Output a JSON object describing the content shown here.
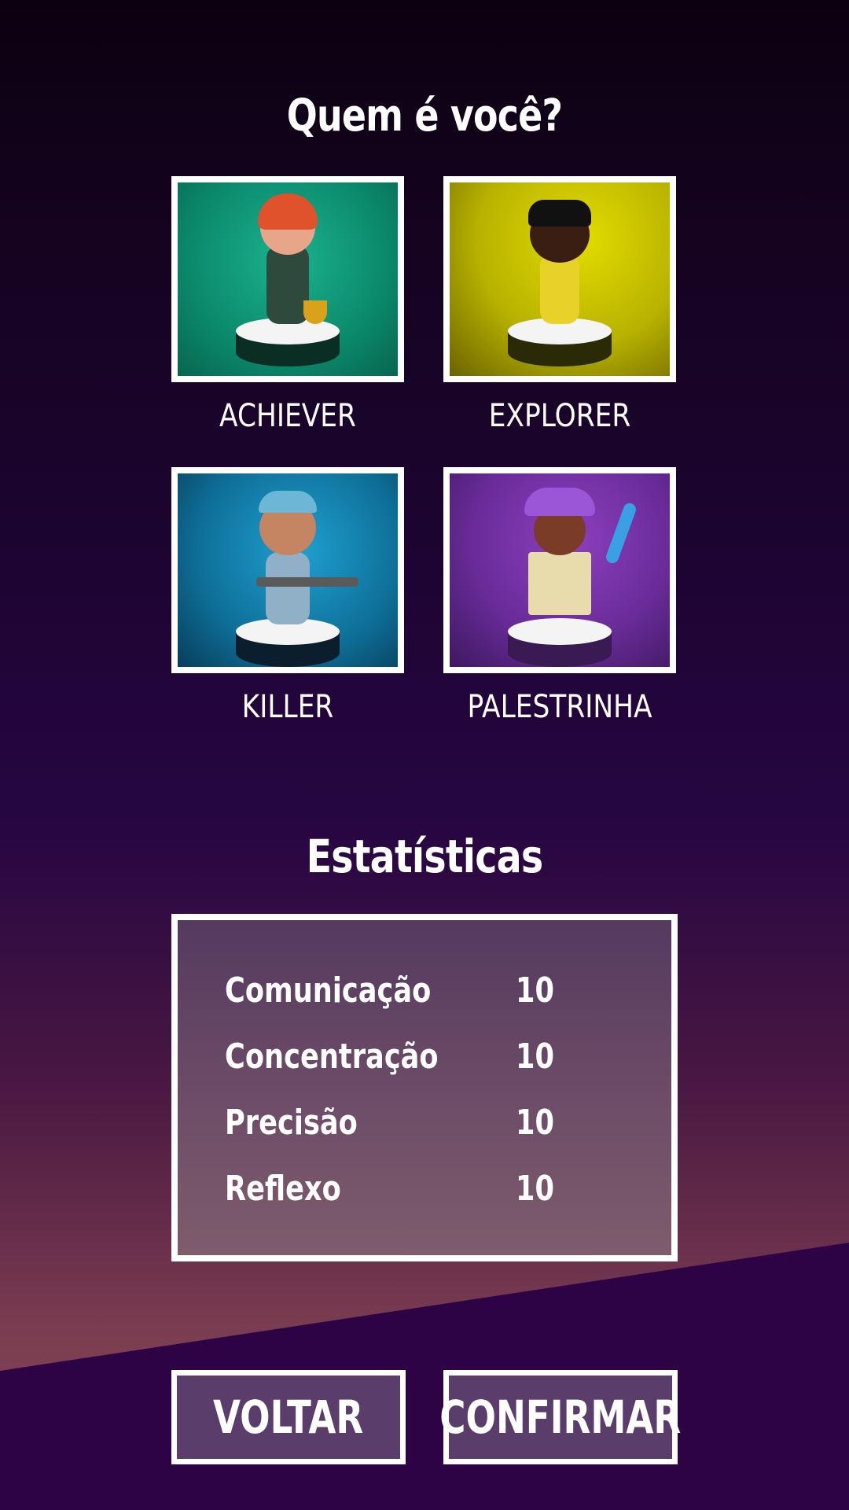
{
  "header": {
    "title": "Quem é você?"
  },
  "profiles": [
    {
      "label": "ACHIEVER",
      "bg": "#0e9c7c"
    },
    {
      "label": "EXPLORER",
      "bg": "#c8c400"
    },
    {
      "label": "KILLER",
      "bg": "#1a8ab8"
    },
    {
      "label": "PALESTRINHA",
      "bg": "#6a2c9a"
    }
  ],
  "stats": {
    "title": "Estatísticas",
    "rows": [
      {
        "name": "Comunicação",
        "value": "10"
      },
      {
        "name": "Concentração",
        "value": "10"
      },
      {
        "name": "Precisão",
        "value": "10"
      },
      {
        "name": "Reflexo",
        "value": "10"
      }
    ]
  },
  "buttons": {
    "back": "VOLTAR",
    "confirm": "CONFIRMAR"
  }
}
